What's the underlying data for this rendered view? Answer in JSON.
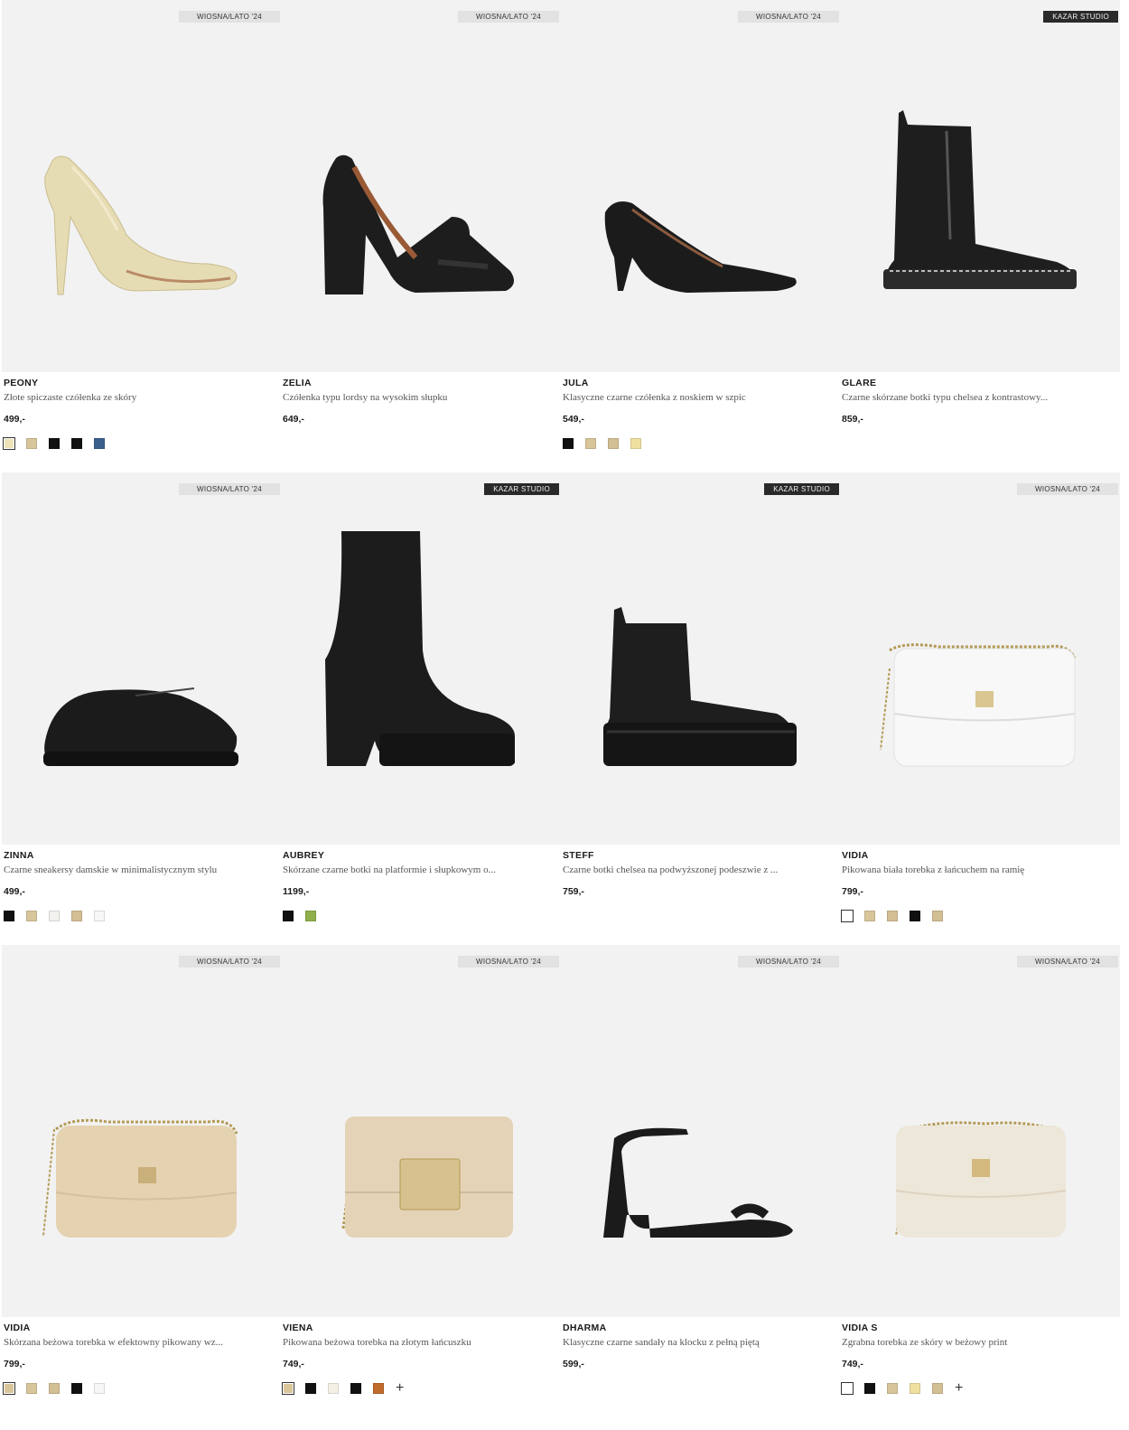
{
  "products": [
    {
      "badge": "WIOSNA/LATO '24",
      "badge_dark": false,
      "name": "PEONY",
      "desc": "Złote spiczaste czółenka ze skóry",
      "price": "499,-",
      "icon": "gold-pump-heel",
      "swatches": [
        "#efe3b8",
        "#d8c59a",
        "#111111",
        "#111111",
        "#3b5f8c"
      ],
      "selected": 0,
      "more": false
    },
    {
      "badge": "WIOSNA/LATO '24",
      "badge_dark": false,
      "name": "ZELIA",
      "desc": "Czółenka typu lordsy na wysokim słupku",
      "price": "649,-",
      "icon": "black-loafer-heel",
      "swatches": [],
      "selected": -1,
      "more": false
    },
    {
      "badge": "WIOSNA/LATO '24",
      "badge_dark": false,
      "name": "JULA",
      "desc": "Klasyczne czarne czółenka z noskiem w szpic",
      "price": "549,-",
      "icon": "black-kitten-pump",
      "swatches": [
        "#111111",
        "#d8c59a",
        "#d3bf94",
        "#efe0a0"
      ],
      "selected": -1,
      "more": false
    },
    {
      "badge": "KAZAR STUDIO",
      "badge_dark": true,
      "name": "GLARE",
      "desc": "Czarne skórzane botki typu chelsea z kontrastowy...",
      "price": "859,-",
      "icon": "black-chelsea-boot",
      "swatches": [],
      "selected": -1,
      "more": false
    },
    {
      "badge": "WIOSNA/LATO '24",
      "badge_dark": false,
      "name": "ZINNA",
      "desc": "Czarne sneakersy damskie w minimalistycznym stylu",
      "price": "499,-",
      "icon": "black-sneaker",
      "swatches": [
        "#111111",
        "#d8c59a",
        "#f3f1ee",
        "#d3bf94",
        "#f7f7f7"
      ],
      "selected": -1,
      "more": false
    },
    {
      "badge": "KAZAR STUDIO",
      "badge_dark": true,
      "name": "AUBREY",
      "desc": "Skórzane czarne botki na platformie i słupkowym o...",
      "price": "1199,-",
      "icon": "black-platform-bootie",
      "swatches": [
        "#111111",
        "#8fb04a"
      ],
      "selected": -1,
      "more": false
    },
    {
      "badge": "KAZAR STUDIO",
      "badge_dark": true,
      "name": "STEFF",
      "desc": "Czarne botki chelsea na podwyższonej podeszwie z ...",
      "price": "759,-",
      "icon": "black-chunky-chelsea",
      "swatches": [],
      "selected": -1,
      "more": false
    },
    {
      "badge": "WIOSNA/LATO '24",
      "badge_dark": false,
      "name": "VIDIA",
      "desc": "Pikowana biała torebka z łańcuchem na ramię",
      "price": "799,-",
      "icon": "white-quilted-bag",
      "swatches": [
        "#ffffff",
        "#d8c59a",
        "#d3bf94",
        "#111111",
        "#d3bf94"
      ],
      "selected": 0,
      "more": false
    },
    {
      "badge": "WIOSNA/LATO '24",
      "badge_dark": false,
      "name": "VIDIA",
      "desc": "Skórzana beżowa torebka w efektowny pikowany wz...",
      "price": "799,-",
      "icon": "beige-quilted-bag",
      "swatches": [
        "#d8c59a",
        "#d8c59a",
        "#d3bf94",
        "#111111",
        "#f7f7f7"
      ],
      "selected": 0,
      "more": false
    },
    {
      "badge": "WIOSNA/LATO '24",
      "badge_dark": false,
      "name": "VIENA",
      "desc": "Pikowana beżowa torebka na złotym łańcuszku",
      "price": "749,-",
      "icon": "beige-chain-bag",
      "swatches": [
        "#d8c59a",
        "#111111",
        "#f3f1e6",
        "#111111",
        "#c06a2b"
      ],
      "selected": 0,
      "more": true
    },
    {
      "badge": "WIOSNA/LATO '24",
      "badge_dark": false,
      "name": "DHARMA",
      "desc": "Klasyczne czarne sandały na klocku z pełną piętą",
      "price": "599,-",
      "icon": "black-block-sandal",
      "swatches": [],
      "selected": -1,
      "more": false
    },
    {
      "badge": "WIOSNA/LATO '24",
      "badge_dark": false,
      "name": "VIDIA S",
      "desc": "Zgrabna torebka ze skóry w beżowy print",
      "price": "749,-",
      "icon": "cream-monogram-bag",
      "swatches": [
        "#ffffff",
        "#111111",
        "#d8c59a",
        "#efe0a0",
        "#d3bf94"
      ],
      "selected": 0,
      "more": true
    }
  ],
  "more_colors_label": "+"
}
